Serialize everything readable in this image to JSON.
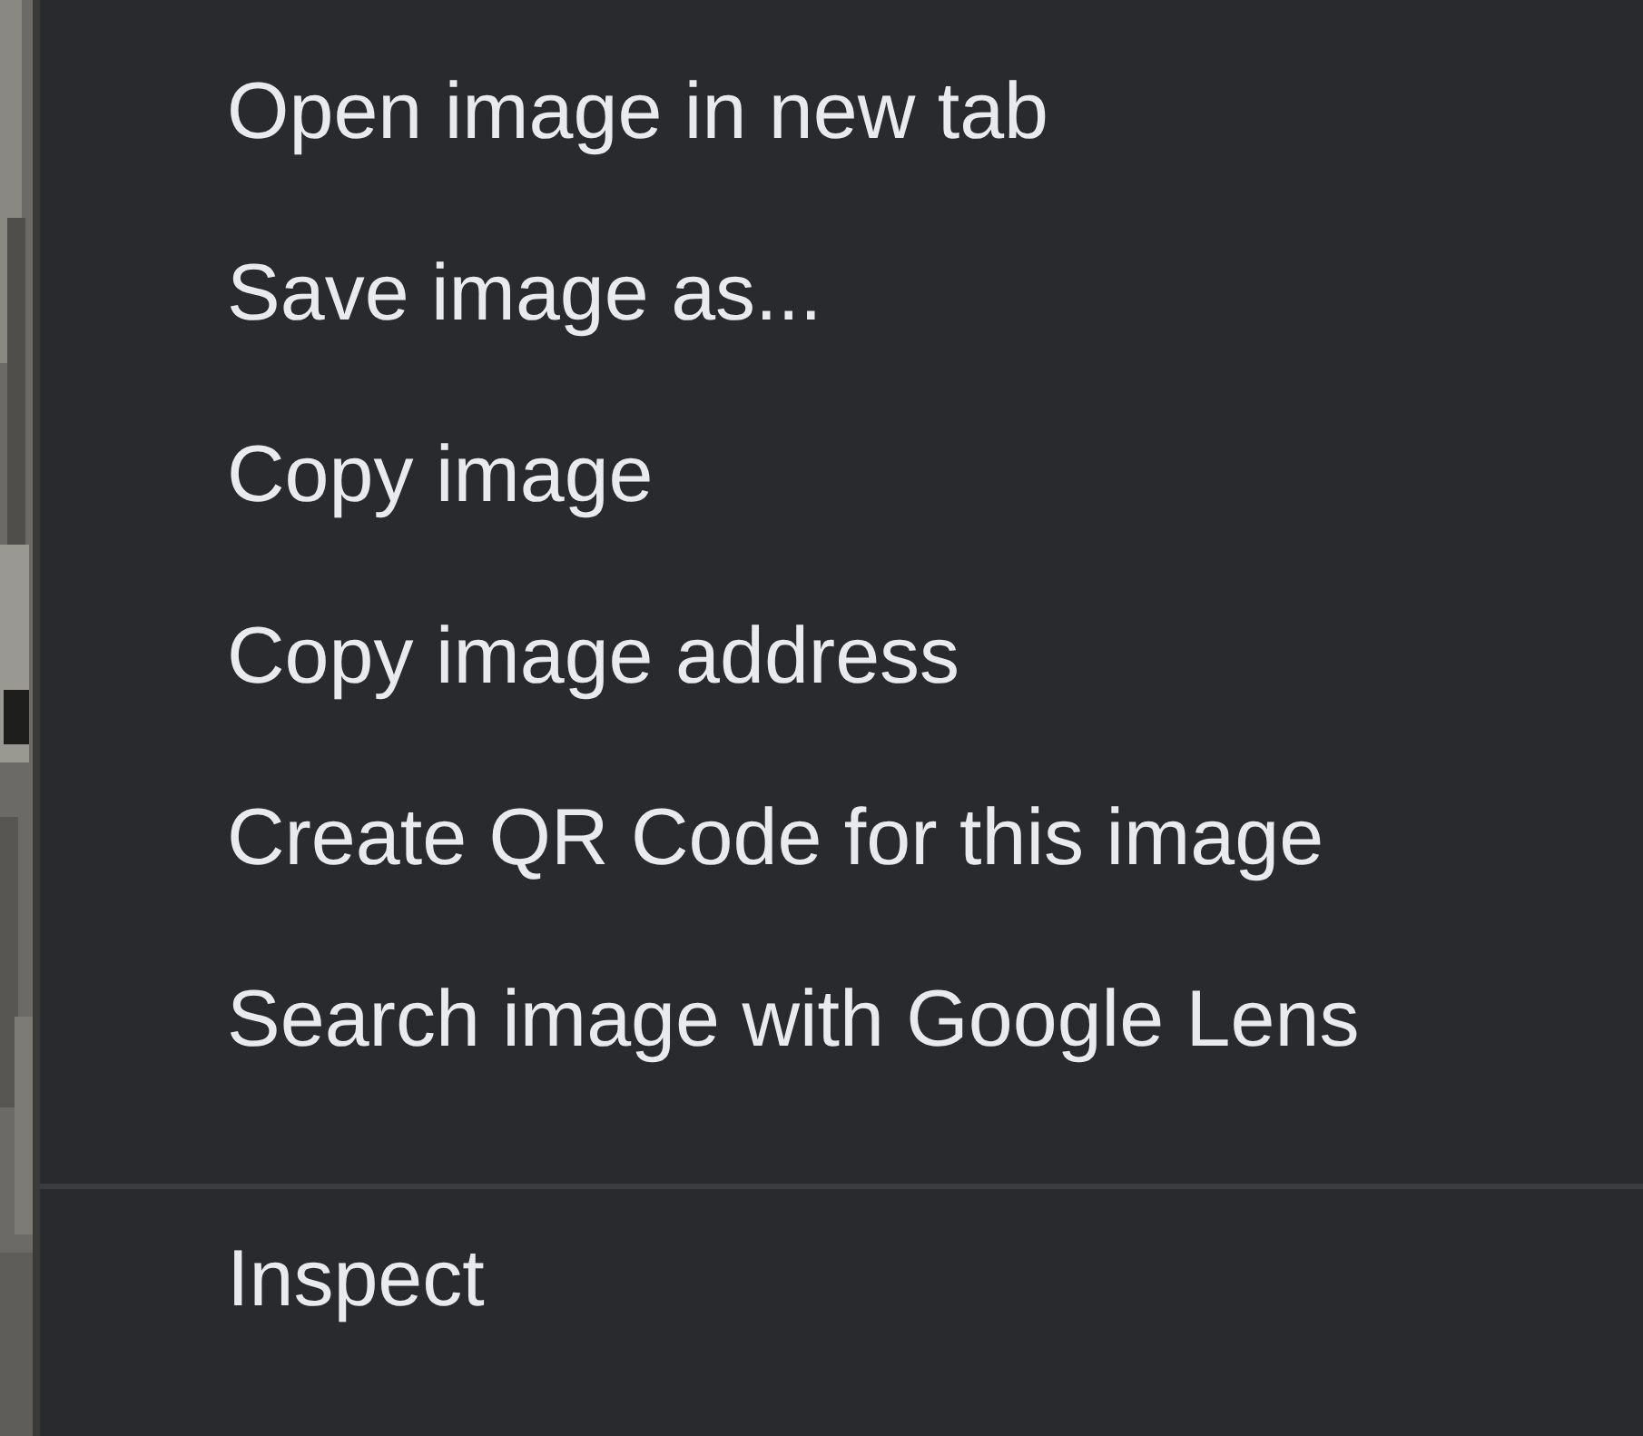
{
  "menu": {
    "sections": [
      {
        "items": [
          {
            "label": "Open image in new tab"
          },
          {
            "label": "Save image as..."
          },
          {
            "label": "Copy image"
          },
          {
            "label": "Copy image address"
          },
          {
            "label": "Create QR Code for this image"
          },
          {
            "label": "Search image with Google Lens"
          }
        ]
      },
      {
        "items": [
          {
            "label": "Inspect"
          }
        ]
      }
    ]
  }
}
